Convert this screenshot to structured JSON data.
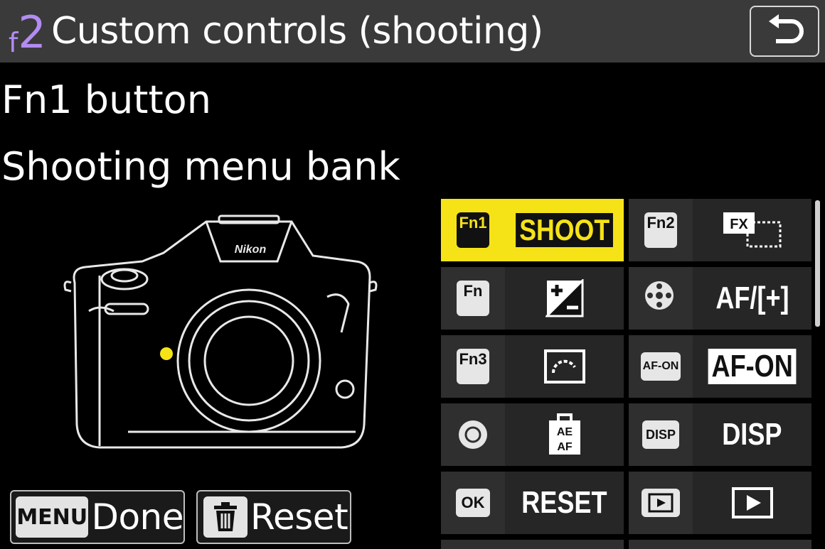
{
  "header": {
    "section_letter": "f",
    "section_number": "2",
    "title": "Custom controls (shooting)",
    "back_icon": "return-arrow-icon"
  },
  "selection": {
    "control_name": "Fn1 button",
    "assignment": "Shooting menu bank"
  },
  "camera": {
    "brand": "Nikon",
    "highlight_color": "#f5e318"
  },
  "footer": {
    "done_key": "MENU",
    "done_label": "Done",
    "reset_icon": "trash-icon",
    "reset_label": "Reset"
  },
  "controls": [
    {
      "icon_text": "Fn1",
      "value": "SHOOT",
      "selected": true
    },
    {
      "icon_text": "Fn2",
      "value_icon": "fx-crop-icon"
    },
    {
      "icon_text": "Fn",
      "value_icon": "exposure-compensation-icon"
    },
    {
      "icon_text": "",
      "value": "AF/[+]"
    },
    {
      "icon_text": "Fn3",
      "value_icon": "picture-control-icon"
    },
    {
      "icon_text": "AF-ON",
      "value": "AF-ON"
    },
    {
      "icon_text": "",
      "value_icon": "ae-af-lock-icon"
    },
    {
      "icon_text": "DISP",
      "value": "DISP"
    },
    {
      "icon_text": "OK",
      "value": "RESET"
    },
    {
      "icon_text": "",
      "value_icon": "playback-icon"
    }
  ],
  "colors": {
    "accent_purple": "#b38cf2",
    "selected_yellow": "#f5e318",
    "header_bg": "#3a3a3a"
  }
}
